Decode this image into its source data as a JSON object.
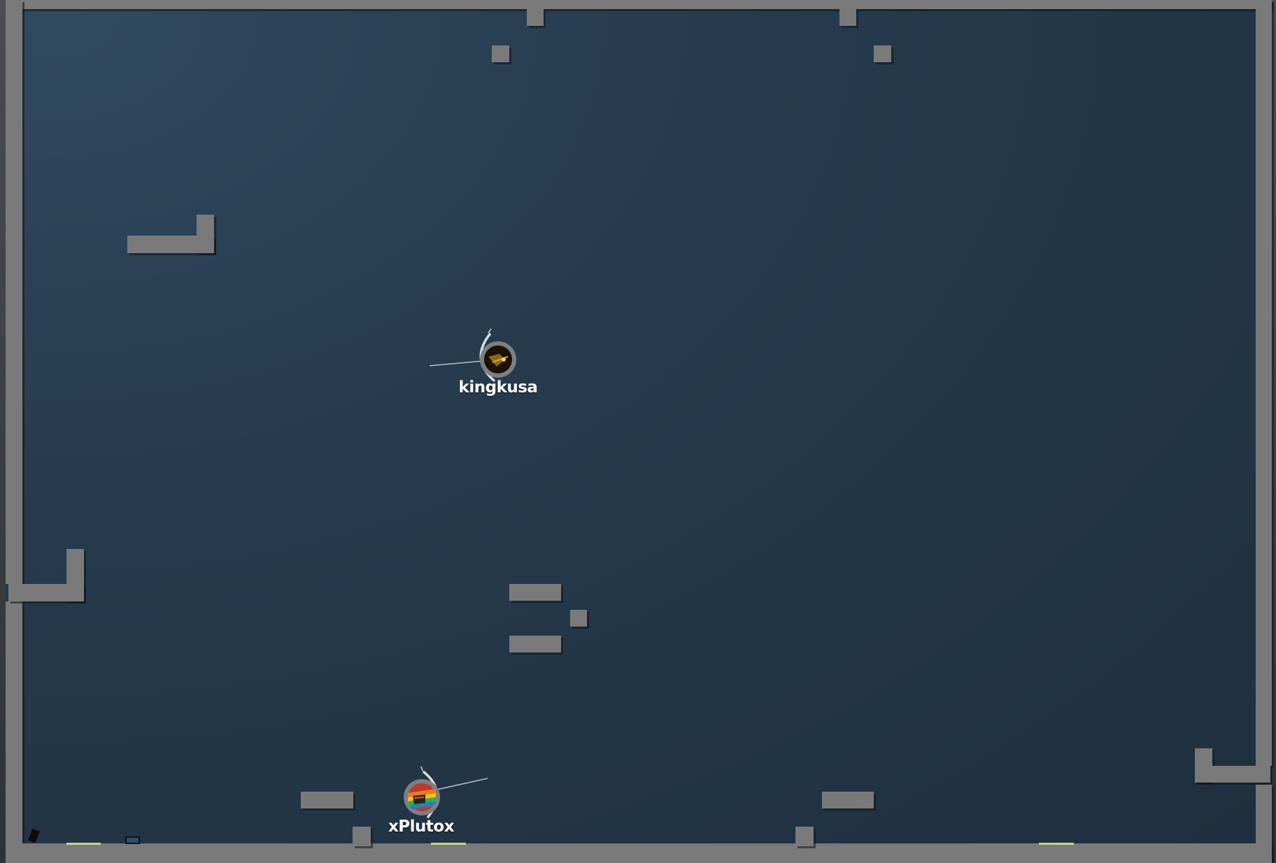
{
  "game": {
    "players": [
      {
        "name": "kingkusa",
        "skin": "dark-gold-ball-icon"
      },
      {
        "name": "xPlutox",
        "skin": "rainbow-flag-ball-icon"
      }
    ]
  },
  "colors": {
    "arena_background": "#243a4e",
    "walls": "#7a7a7a",
    "spawn_pads": "#c6d38a",
    "player_name": "#ffffff"
  }
}
